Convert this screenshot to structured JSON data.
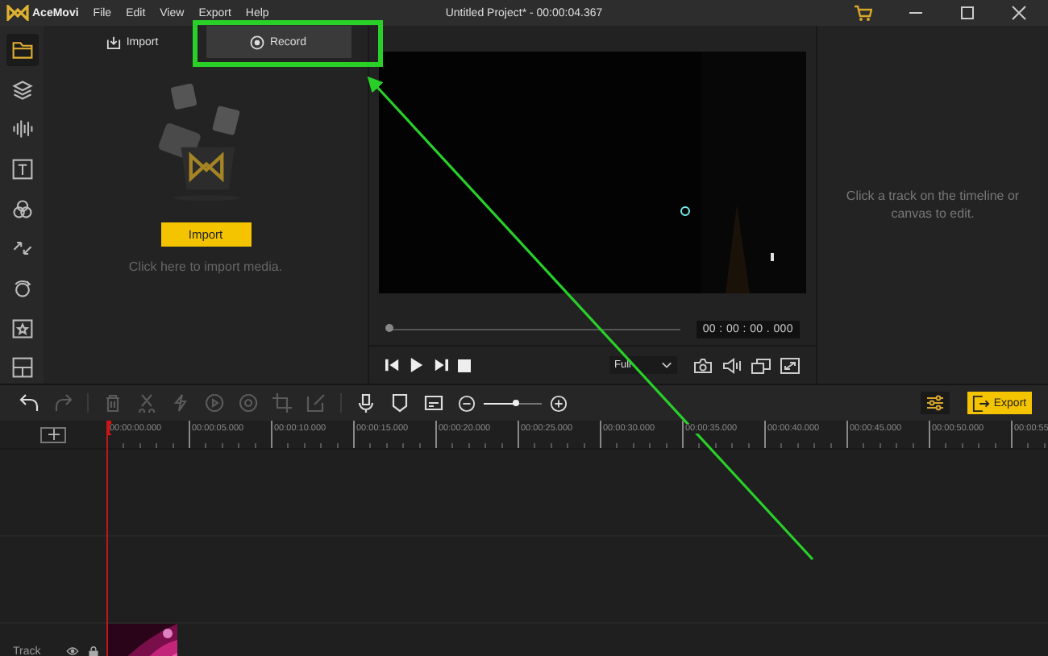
{
  "app": {
    "name": "AceMovi",
    "menu": [
      "File",
      "Edit",
      "View",
      "Export",
      "Help"
    ],
    "title": "Untitled Project* - 00:00:04.367"
  },
  "sidebar": {
    "items": [
      {
        "kind": "folder",
        "selected": true
      },
      {
        "kind": "layers",
        "selected": false
      },
      {
        "kind": "audio",
        "selected": false
      },
      {
        "kind": "text",
        "selected": false
      },
      {
        "kind": "filter",
        "selected": false
      },
      {
        "kind": "transition",
        "selected": false
      },
      {
        "kind": "motion",
        "selected": false
      },
      {
        "kind": "sticker",
        "selected": false
      },
      {
        "kind": "layout",
        "selected": false
      }
    ]
  },
  "media_panel": {
    "tabs": [
      {
        "label": "Import",
        "kind": "import",
        "selected": false
      },
      {
        "label": "Record",
        "kind": "record",
        "selected": true
      }
    ],
    "import_button": "Import",
    "hint": "Click here to import media."
  },
  "preview": {
    "progress": {
      "level": 0
    },
    "timecode": "00 : 00 : 00 . 000",
    "zoom": "Full"
  },
  "properties_hint": "Click a track on the timeline or canvas to edit.",
  "toolbar": {
    "tools": [
      {
        "kind": "undo",
        "disabled": false
      },
      {
        "kind": "redo",
        "disabled": true
      },
      {
        "kind": "delete",
        "disabled": true
      },
      {
        "kind": "cut",
        "disabled": true
      },
      {
        "kind": "split",
        "disabled": true
      },
      {
        "kind": "speed",
        "disabled": true
      },
      {
        "kind": "target",
        "disabled": true
      },
      {
        "kind": "crop",
        "disabled": true
      },
      {
        "kind": "edit",
        "disabled": true
      },
      {
        "kind": "mic",
        "disabled": false
      },
      {
        "kind": "marker",
        "disabled": false
      },
      {
        "kind": "caption",
        "disabled": false
      }
    ],
    "zoom": {
      "level": 0.55
    },
    "export_button": "Export"
  },
  "ruler": [
    "00:00:00.000",
    "00:00:05.000",
    "00:00:10.000",
    "00:00:15.000",
    "00:00:20.000",
    "00:00:25.000",
    "00:00:30.000",
    "00:00:35.000",
    "00:00:40.000",
    "00:00:45.000",
    "00:00:50.000",
    "00:00:55"
  ],
  "track": {
    "label": "Track"
  }
}
